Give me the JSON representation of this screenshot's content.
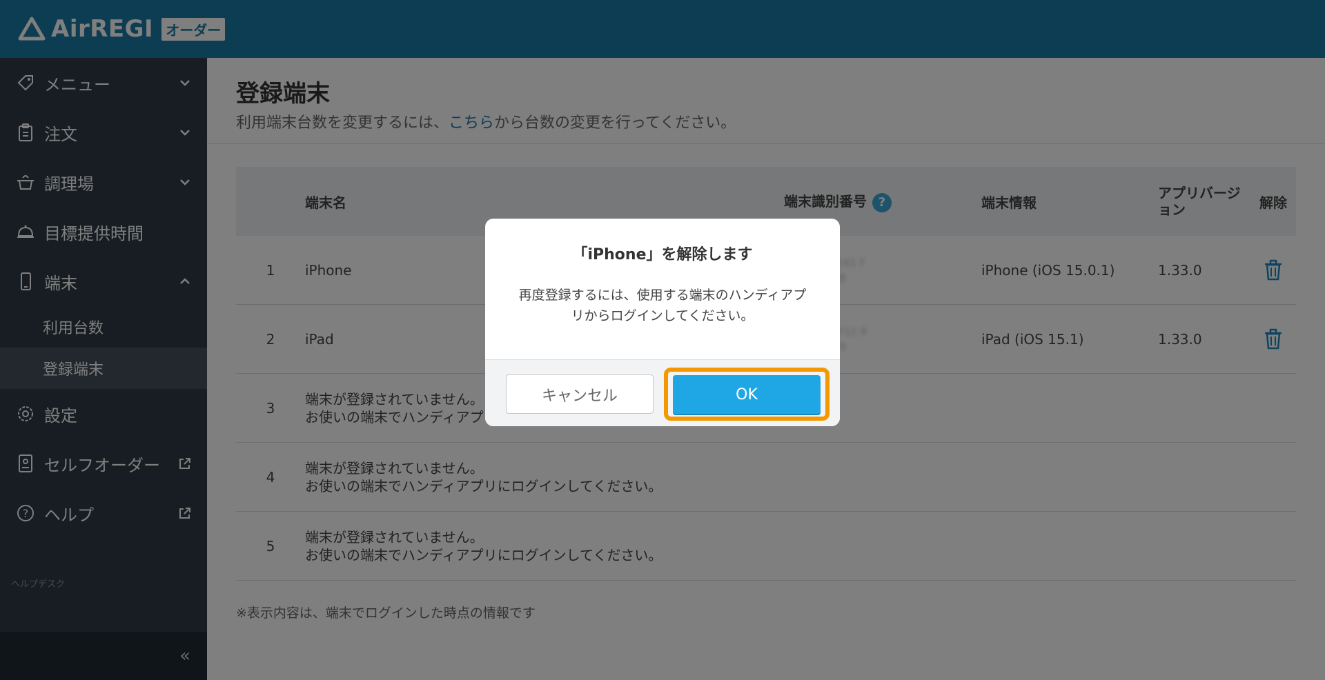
{
  "header": {
    "logo_text": "AirREGI",
    "logo_badge": "オーダー"
  },
  "sidebar": {
    "items": [
      {
        "label": "メニュー",
        "icon": "tag-icon",
        "chevron": "down"
      },
      {
        "label": "注文",
        "icon": "clipboard-icon",
        "chevron": "down"
      },
      {
        "label": "調理場",
        "icon": "pot-icon",
        "chevron": "down"
      },
      {
        "label": "目標提供時間",
        "icon": "cloche-icon"
      },
      {
        "label": "端末",
        "icon": "smartphone-icon",
        "chevron": "up"
      }
    ],
    "sub_items": [
      {
        "label": "利用台数"
      },
      {
        "label": "登録端末"
      }
    ],
    "bottom_items": [
      {
        "label": "設定",
        "icon": "gear-icon"
      },
      {
        "label": "セルフオーダー",
        "icon": "self-order-icon"
      },
      {
        "label": "ヘルプ",
        "icon": "help-icon"
      }
    ],
    "helpdesk": "ヘルプデスク",
    "collapse": "«"
  },
  "main": {
    "title": "登録端末",
    "subtitle_pre": "利用端末台数を変更するには、",
    "subtitle_link": "こちら",
    "subtitle_post": "から台数の変更を行ってください。",
    "columns": {
      "name": "端末名",
      "id": "端末識別番号",
      "info": "端末情報",
      "version": "アプリバージョン",
      "remove": "解除"
    },
    "rows": [
      {
        "no": "1",
        "name": "iPhone",
        "id_line1": "8b 1418 4141 F",
        "id_line2": "6DFD8419B",
        "info": "iPhone (iOS 15.0.1)",
        "version": "1.33.0"
      },
      {
        "no": "2",
        "name": "iPad",
        "id_line1": "54 A78C 4F12 8",
        "id_line2": "AAC2A8B49",
        "info": "iPad (iOS 15.1)",
        "version": "1.33.0"
      }
    ],
    "empty_rows": [
      {
        "no": "3",
        "line1": "端末が登録されていません。",
        "line2": "お使いの端末でハンディアプリにログインしてください。"
      },
      {
        "no": "4",
        "line1": "端末が登録されていません。",
        "line2": "お使いの端末でハンディアプリにログインしてください。"
      },
      {
        "no": "5",
        "line1": "端末が登録されていません。",
        "line2": "お使いの端末でハンディアプリにログインしてください。"
      }
    ],
    "footnote": "※表示内容は、端末でログインした時点の情報です"
  },
  "modal": {
    "title": "「iPhone」を解除します",
    "body_line1": "再度登録するには、使用する端末のハンディアプ",
    "body_line2": "リからログインしてください。",
    "cancel": "キャンセル",
    "ok": "OK"
  }
}
